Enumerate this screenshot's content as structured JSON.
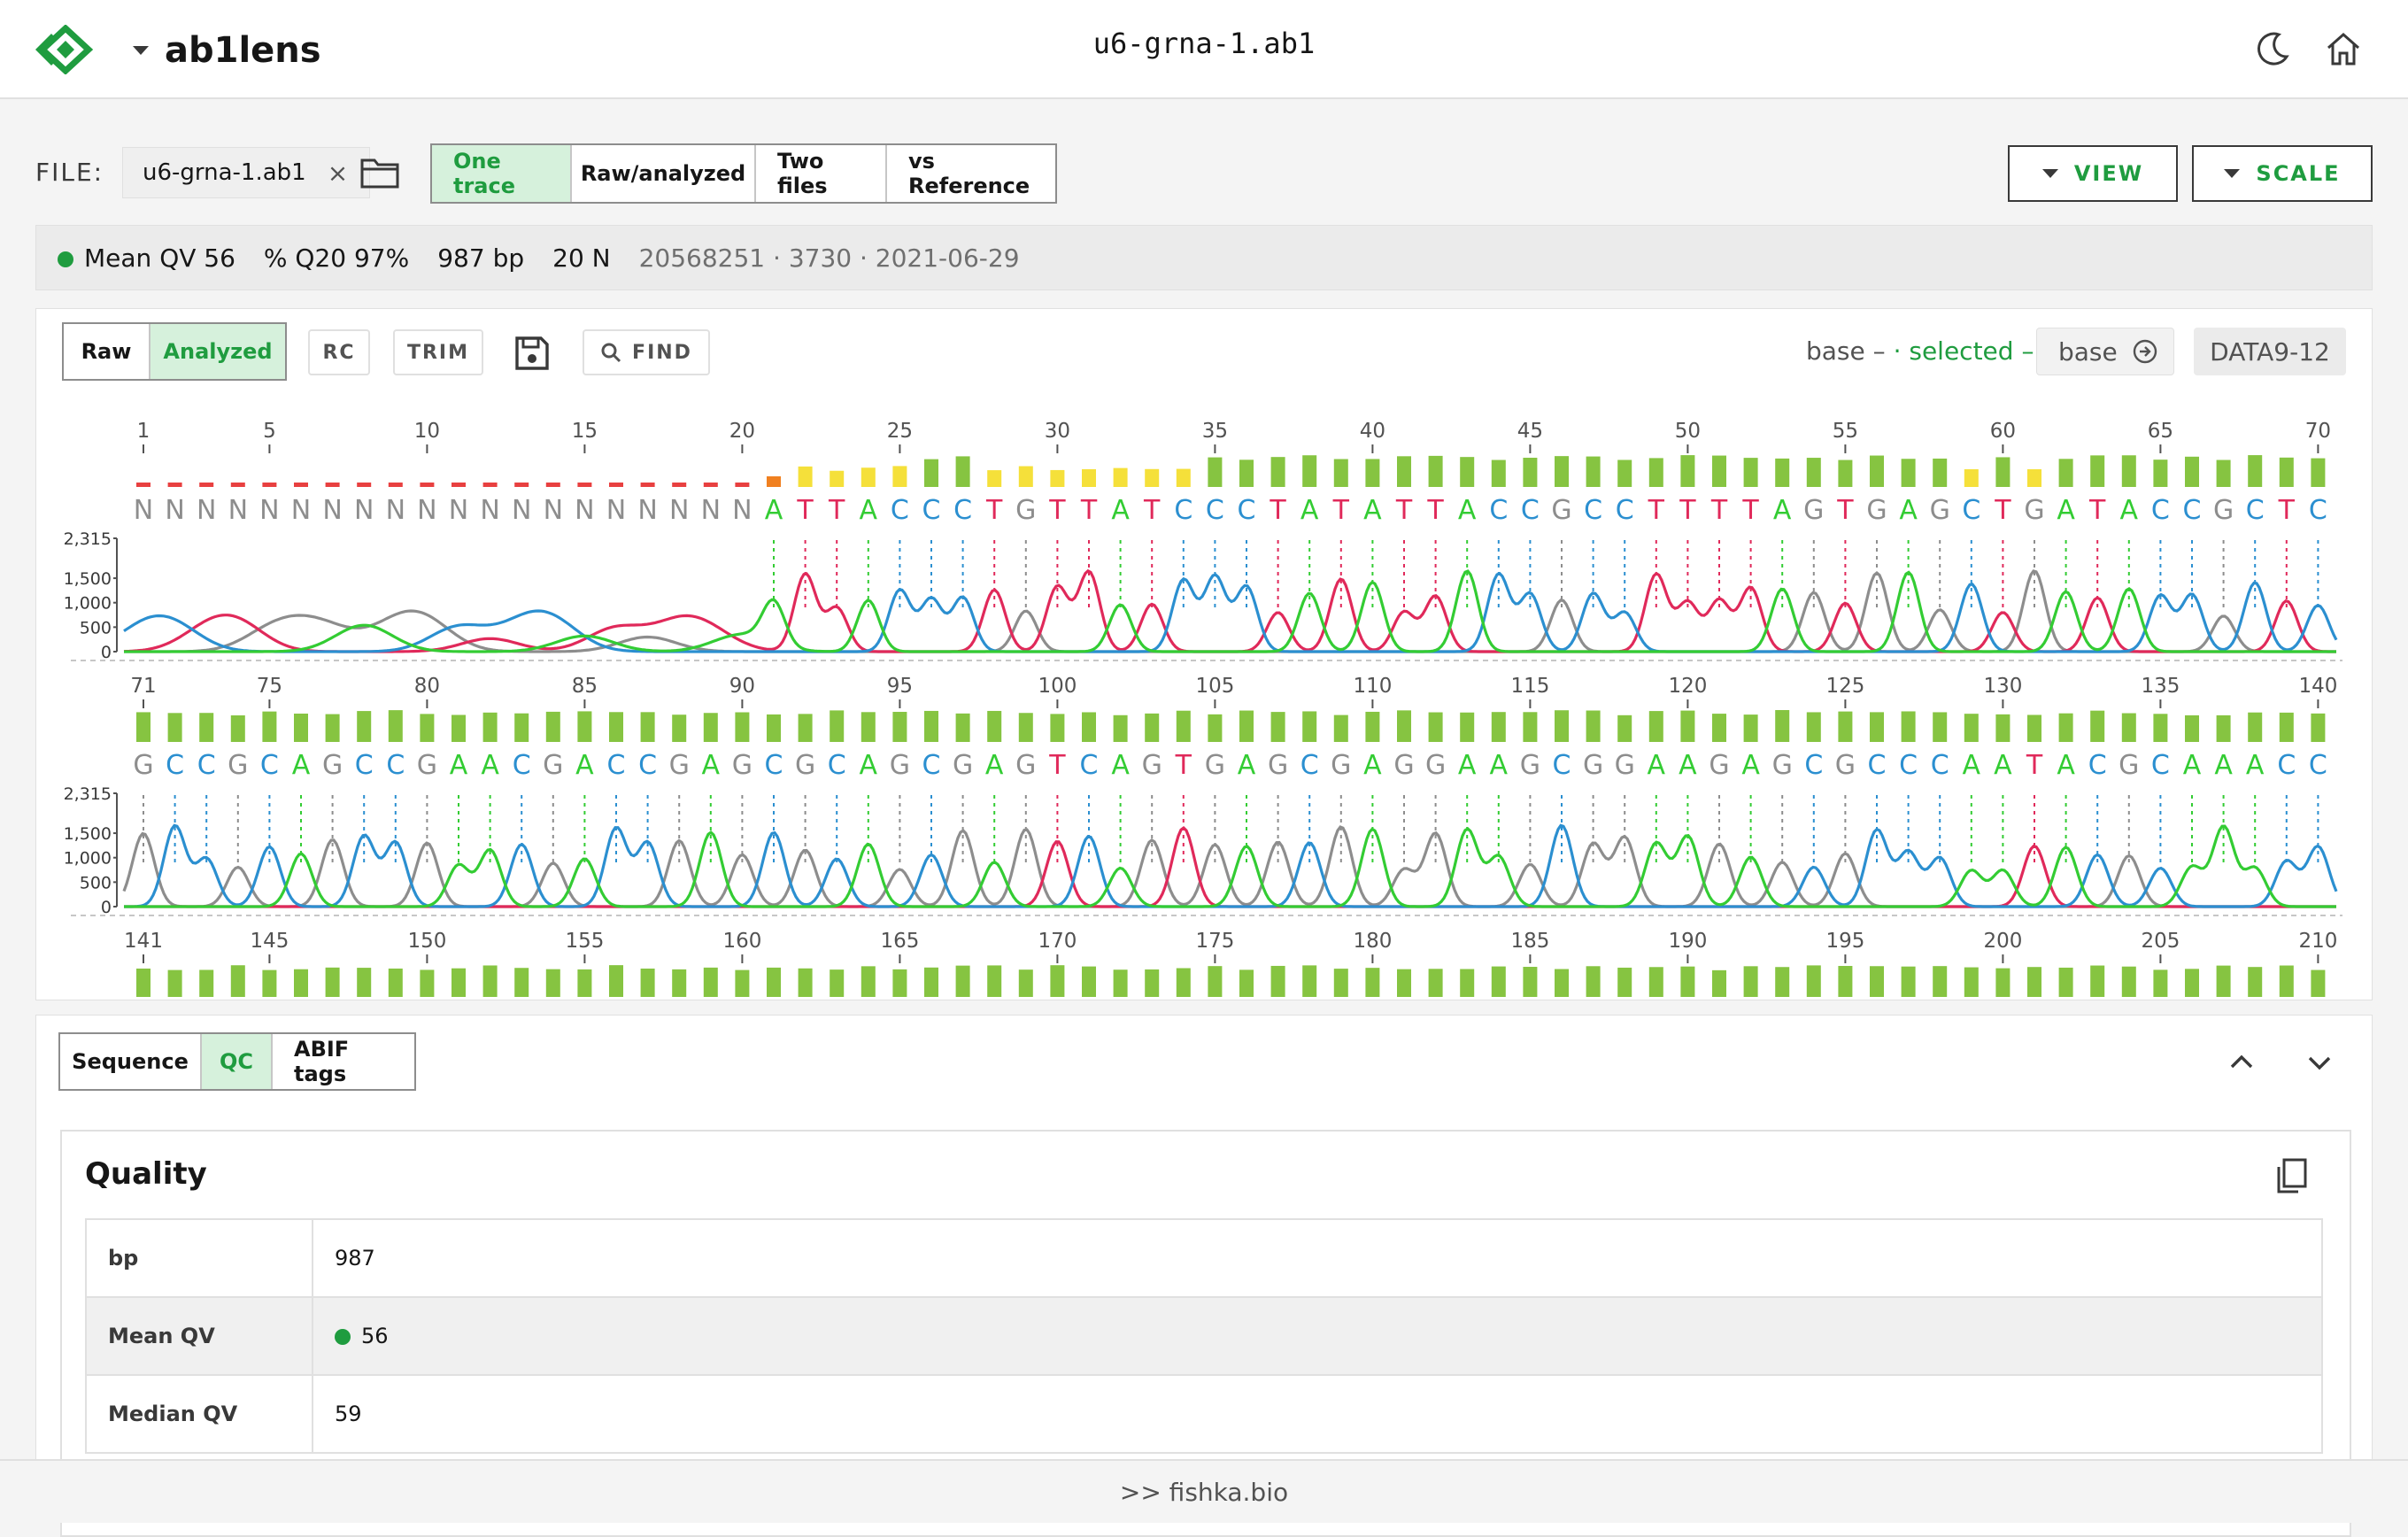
{
  "header": {
    "app_name": "ab1lens",
    "file_title": "u6-grna-1.ab1"
  },
  "file_row": {
    "label": "FILE:",
    "chip": "u6-grna-1.ab1",
    "close_glyph": "×",
    "modes": [
      "One trace",
      "Raw/analyzed",
      "Two files",
      "vs Reference"
    ],
    "active_mode": 0,
    "view_label": "VIEW",
    "scale_label": "SCALE"
  },
  "stats": {
    "mean_qv": "Mean QV 56",
    "q20": "% Q20 97%",
    "bp": "987 bp",
    "n": "20 N",
    "meta": "20568251 · 3730 · 2021-06-29"
  },
  "trace_toolbar": {
    "raw": "Raw",
    "analyzed": "Analyzed",
    "rc": "RC",
    "trim": "TRIM",
    "find": "FIND",
    "legend_base": "base –",
    "legend_selected": "· selected –",
    "base_value": "base",
    "data_tag": "DATA9-12"
  },
  "trace": {
    "sequence": "NNNNNNNNNNNNNNNNNNNNATTACCCTGTTATCCCTATATTACCGCCTTTTAGTGAGCTGATACCGCTCGCCGCAGCCGAACGACCGAGCGCAGCGAGTCAGTGAGCGAGGAAGCGGAAGAGCGCCCAATACGCAAACC",
    "bases_per_row": 70,
    "tick_positions": [
      1,
      5,
      10,
      15,
      20,
      25,
      30,
      35,
      40,
      45,
      50,
      55,
      60,
      65,
      70
    ],
    "row3_ticks": [
      "141",
      "145",
      "150",
      "155",
      "160",
      "165",
      "170",
      "175",
      "180",
      "185",
      "190",
      "195",
      "200",
      "205",
      "210"
    ],
    "y_ticks": [
      "2,315",
      "1,500",
      "1,000",
      "500",
      "0"
    ],
    "colors": {
      "A": "#33cc33",
      "C": "#2b8fd0",
      "G": "#8d8d8d",
      "T": "#e0295a",
      "N": "#8d8d8d"
    }
  },
  "bottom": {
    "tabs": [
      "Sequence",
      "QC",
      "ABIF tags"
    ],
    "active_tab": 1,
    "quality_title": "Quality",
    "quality_rows": [
      {
        "key": "bp",
        "value": "987"
      },
      {
        "key": "Mean QV",
        "value": "56"
      },
      {
        "key": "Median QV",
        "value": "59"
      }
    ]
  },
  "footer": {
    "text": ">> fishka.bio"
  }
}
